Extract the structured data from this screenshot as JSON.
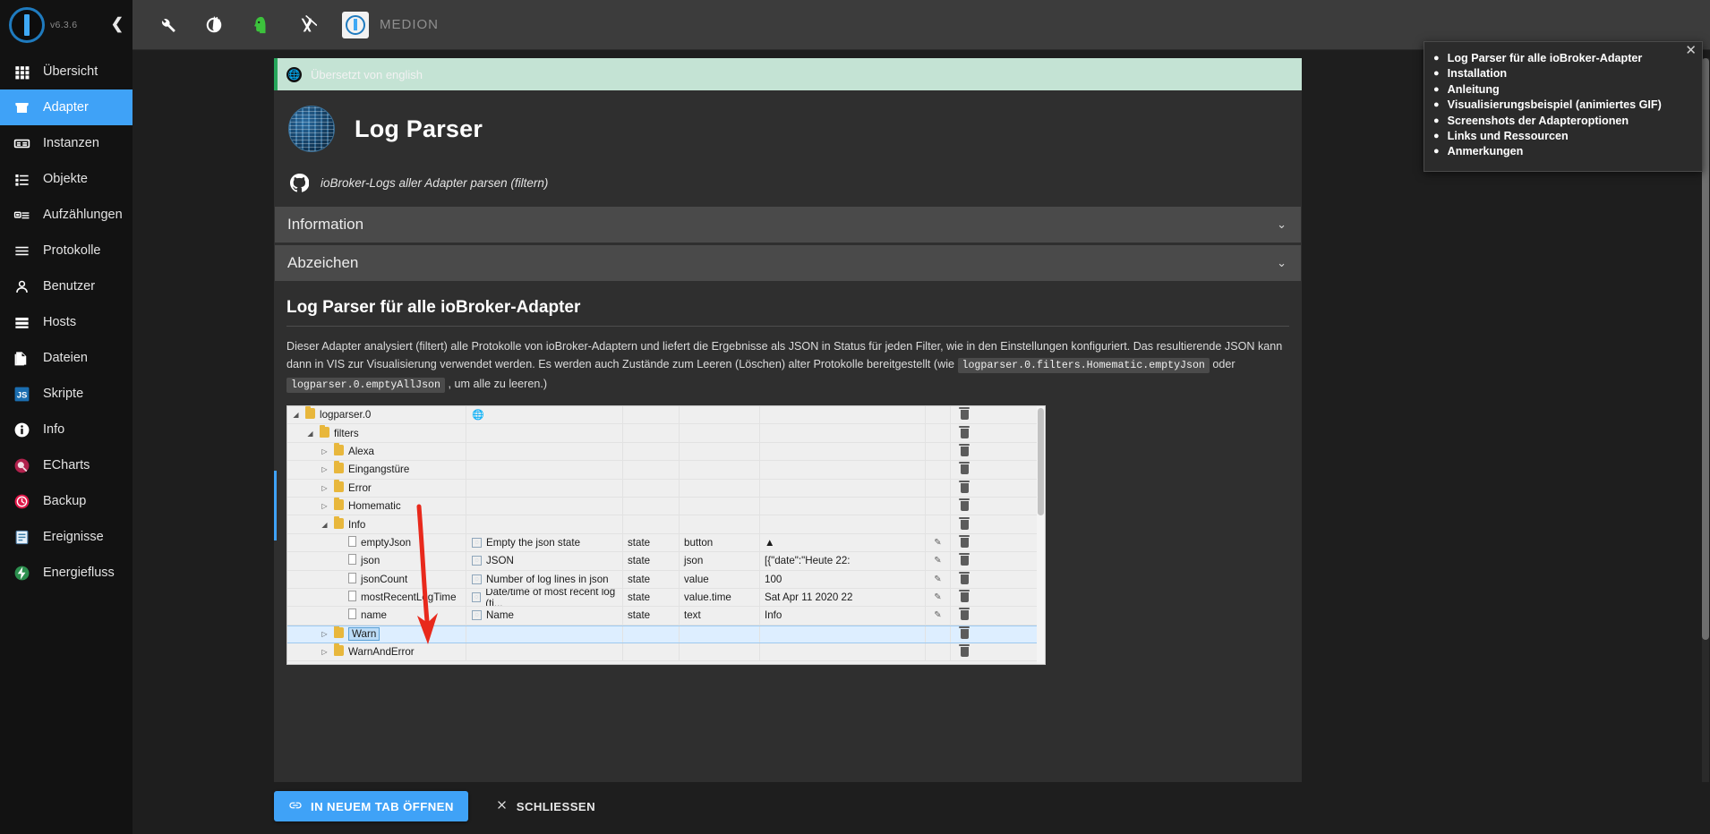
{
  "sidebar": {
    "version": "v6.3.6",
    "collapse_icon": "chevron-left-icon",
    "items": [
      {
        "label": "Übersicht",
        "icon": "grid-icon",
        "active": false
      },
      {
        "label": "Adapter",
        "icon": "store-icon",
        "active": true
      },
      {
        "label": "Instanzen",
        "icon": "instances-icon",
        "active": false
      },
      {
        "label": "Objekte",
        "icon": "list-icon",
        "active": false
      },
      {
        "label": "Aufzählungen",
        "icon": "enums-icon",
        "active": false
      },
      {
        "label": "Protokolle",
        "icon": "lines-icon",
        "active": false
      },
      {
        "label": "Benutzer",
        "icon": "person-icon",
        "active": false
      },
      {
        "label": "Hosts",
        "icon": "server-icon",
        "active": false
      },
      {
        "label": "Dateien",
        "icon": "files-icon",
        "active": false
      },
      {
        "label": "Skripte",
        "icon": "js-icon",
        "active": false
      },
      {
        "label": "Info",
        "icon": "info-icon",
        "active": false
      },
      {
        "label": "ECharts",
        "icon": "echarts-icon",
        "active": false
      },
      {
        "label": "Backup",
        "icon": "backup-clock-icon",
        "active": false
      },
      {
        "label": "Ereignisse",
        "icon": "events-icon",
        "active": false
      },
      {
        "label": "Energiefluss",
        "icon": "energy-icon",
        "active": false
      }
    ]
  },
  "toolbar": {
    "icons": [
      "wrench-icon",
      "contrast-icon",
      "expert-head-icon",
      "sync-off-icon"
    ],
    "brand": "MEDION"
  },
  "dialog": {
    "translation_banner": "Übersetzt von english",
    "adapter_title": "Log Parser",
    "github_subtitle": "ioBroker-Logs aller Adapter parsen (filtern)",
    "accordions": [
      {
        "label": "Information"
      },
      {
        "label": "Abzeichen"
      }
    ],
    "section_heading": "Log Parser für alle ioBroker-Adapter",
    "paragraph_1": "Dieser Adapter analysiert (filtert) alle Protokolle von ioBroker-Adaptern und liefert die Ergebnisse als JSON in Status für jeden Filter, wie in den Einstellungen konfiguriert. Das resultierende JSON kann dann in VIS zur",
    "paragraph_2a": "Visualisierung verwendet werden. Es werden auch Zustände zum Leeren (Löschen) alter Protokolle bereitgestellt (wie",
    "code_1": "logparser.0.filters.Homematic.emptyJson",
    "paragraph_2b": "oder",
    "code_2": "logparser.0.emptyAllJson",
    "paragraph_2c": ", um alle zu leeren.)",
    "footer": {
      "open_new_tab": "IN NEUEM TAB ÖFFNEN",
      "open_new_tab_icon": "link-icon",
      "close": "SCHLIESSEN",
      "close_icon": "close-x-icon"
    }
  },
  "tree": {
    "rows": [
      {
        "indent": 0,
        "caret": "down",
        "icon": "folder-icon",
        "name": "logparser.0",
        "desc": "",
        "desc_icon": "globe-icon",
        "role": "",
        "type": "",
        "value": "",
        "edit": false,
        "del": true,
        "selected": false
      },
      {
        "indent": 1,
        "caret": "down",
        "icon": "folder-icon",
        "name": "filters",
        "desc": "",
        "desc_icon": "",
        "role": "",
        "type": "",
        "value": "",
        "edit": false,
        "del": true,
        "selected": false
      },
      {
        "indent": 2,
        "caret": "right",
        "icon": "folder-icon",
        "name": "Alexa",
        "desc": "",
        "desc_icon": "",
        "role": "",
        "type": "",
        "value": "",
        "edit": false,
        "del": true,
        "selected": false
      },
      {
        "indent": 2,
        "caret": "right",
        "icon": "folder-icon",
        "name": "Eingangstüre",
        "desc": "",
        "desc_icon": "",
        "role": "",
        "type": "",
        "value": "",
        "edit": false,
        "del": true,
        "selected": false
      },
      {
        "indent": 2,
        "caret": "right",
        "icon": "folder-icon",
        "name": "Error",
        "desc": "",
        "desc_icon": "",
        "role": "",
        "type": "",
        "value": "",
        "edit": false,
        "del": true,
        "selected": false
      },
      {
        "indent": 2,
        "caret": "right",
        "icon": "folder-icon",
        "name": "Homematic",
        "desc": "",
        "desc_icon": "",
        "role": "",
        "type": "",
        "value": "",
        "edit": false,
        "del": true,
        "selected": false
      },
      {
        "indent": 2,
        "caret": "down",
        "icon": "folder-icon",
        "name": "Info",
        "desc": "",
        "desc_icon": "",
        "role": "",
        "type": "",
        "value": "",
        "edit": false,
        "del": true,
        "selected": false
      },
      {
        "indent": 3,
        "caret": "none",
        "icon": "doc-icon",
        "name": "emptyJson",
        "desc": "Empty the json state",
        "desc_icon": "state-icon",
        "role": "state",
        "type": "button",
        "value": "▲",
        "edit": true,
        "del": true,
        "selected": false
      },
      {
        "indent": 3,
        "caret": "none",
        "icon": "doc-icon",
        "name": "json",
        "desc": "JSON",
        "desc_icon": "state-icon",
        "role": "state",
        "type": "json",
        "value": "[{\"date\":\"Heute 22:",
        "edit": true,
        "del": true,
        "selected": false
      },
      {
        "indent": 3,
        "caret": "none",
        "icon": "doc-icon",
        "name": "jsonCount",
        "desc": "Number of log lines in json",
        "desc_icon": "state-icon",
        "role": "state",
        "type": "value",
        "value": "100",
        "edit": true,
        "del": true,
        "selected": false
      },
      {
        "indent": 3,
        "caret": "none",
        "icon": "doc-icon",
        "name": "mostRecentLogTime",
        "desc": "Date/time of most recent log (ti...",
        "desc_icon": "state-icon",
        "role": "state",
        "type": "value.time",
        "value": "Sat Apr 11 2020 22",
        "edit": true,
        "del": true,
        "selected": false
      },
      {
        "indent": 3,
        "caret": "none",
        "icon": "doc-icon",
        "name": "name",
        "desc": "Name",
        "desc_icon": "state-icon",
        "role": "state",
        "type": "text",
        "value": "Info",
        "edit": true,
        "del": true,
        "selected": false
      },
      {
        "indent": 2,
        "caret": "right",
        "icon": "folder-icon",
        "name": "Warn",
        "desc": "",
        "desc_icon": "",
        "role": "",
        "type": "",
        "value": "",
        "edit": false,
        "del": true,
        "selected": true
      },
      {
        "indent": 2,
        "caret": "right",
        "icon": "folder-icon",
        "name": "WarnAndError",
        "desc": "",
        "desc_icon": "",
        "role": "",
        "type": "",
        "value": "",
        "edit": false,
        "del": true,
        "selected": false
      }
    ]
  },
  "toc": {
    "close_icon": "close-icon",
    "items": [
      "Log Parser für alle ioBroker-Adapter",
      "Installation",
      "Anleitung",
      "Visualisierungsbeispiel (animiertes GIF)",
      "Screenshots der Adapteroptionen",
      "Links und Ressourcen",
      "Anmerkungen"
    ]
  },
  "annotation": {
    "arrow_color": "#e8291c"
  }
}
